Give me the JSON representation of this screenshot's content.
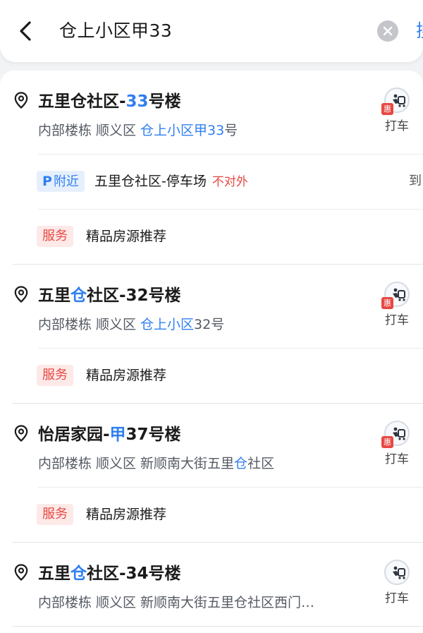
{
  "search": {
    "query": "仓上小区甲33",
    "action_peek": "搜"
  },
  "results": [
    {
      "title_parts": [
        {
          "text": "五里仓社区-",
          "hl": false
        },
        {
          "text": "33",
          "hl": true
        },
        {
          "text": "号楼",
          "hl": false
        }
      ],
      "type": "内部楼栋",
      "district": "顺义区",
      "address_parts": [
        {
          "text": "仓上小区甲33",
          "hl": true
        },
        {
          "text": "号",
          "hl": false
        }
      ],
      "taxi_label": "打车",
      "taxi_badge": "惠",
      "parking": {
        "tag_p": "P",
        "tag_label": "附近",
        "name": "五里仓社区-停车场",
        "status": "不对外",
        "arrive": "到"
      },
      "service": {
        "tag": "服务",
        "text": "精品房源推荐"
      }
    },
    {
      "title_parts": [
        {
          "text": "五里",
          "hl": false
        },
        {
          "text": "仓",
          "hl": true
        },
        {
          "text": "社区-32号楼",
          "hl": false
        }
      ],
      "type": "内部楼栋",
      "district": "顺义区",
      "address_parts": [
        {
          "text": "仓上小区",
          "hl": true
        },
        {
          "text": "32号",
          "hl": false
        }
      ],
      "taxi_label": "打车",
      "taxi_badge": "惠",
      "service": {
        "tag": "服务",
        "text": "精品房源推荐"
      }
    },
    {
      "title_parts": [
        {
          "text": "怡居家园-",
          "hl": false
        },
        {
          "text": "甲",
          "hl": true
        },
        {
          "text": "37号楼",
          "hl": false
        }
      ],
      "type": "内部楼栋",
      "district": "顺义区",
      "address_parts": [
        {
          "text": "新顺南大街五里",
          "hl": false
        },
        {
          "text": "仓",
          "hl": true
        },
        {
          "text": "社区",
          "hl": false
        }
      ],
      "taxi_label": "打车",
      "taxi_badge": "惠",
      "service": {
        "tag": "服务",
        "text": "精品房源推荐"
      }
    },
    {
      "title_parts": [
        {
          "text": "五里",
          "hl": false
        },
        {
          "text": "仓",
          "hl": true
        },
        {
          "text": "社区-34号楼",
          "hl": false
        }
      ],
      "type": "内部楼栋",
      "district": "顺义区",
      "address_parts": [
        {
          "text": "新顺南大街五里仓社区西门…",
          "hl": false
        }
      ],
      "taxi_label": "打车",
      "taxi_badge": ""
    }
  ],
  "colors": {
    "accent": "#2f7ff2",
    "warn": "#e74842"
  },
  "icons": {
    "back": "chevron-left-icon",
    "clear": "close-circle-icon",
    "location": "location-pin-icon",
    "taxi": "taxi-icon"
  }
}
